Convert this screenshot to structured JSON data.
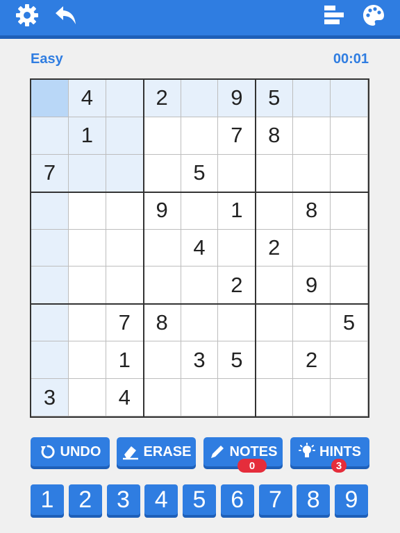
{
  "header": {
    "icons": [
      "gear-icon",
      "undo-arrow-icon",
      "stats-icon",
      "palette-icon"
    ]
  },
  "status": {
    "difficulty": "Easy",
    "timer": "00:01"
  },
  "board": {
    "rows": [
      [
        "",
        "4",
        "",
        "2",
        "",
        "9",
        "5",
        "",
        ""
      ],
      [
        "",
        "1",
        "",
        "",
        "",
        "7",
        "8",
        "",
        ""
      ],
      [
        "7",
        "",
        "",
        "",
        "5",
        "",
        "",
        "",
        ""
      ],
      [
        "",
        "",
        "",
        "9",
        "",
        "1",
        "",
        "8",
        ""
      ],
      [
        "",
        "",
        "",
        "",
        "4",
        "",
        "2",
        "",
        ""
      ],
      [
        "",
        "",
        "",
        "",
        "",
        "2",
        "",
        "9",
        ""
      ],
      [
        "",
        "",
        "7",
        "8",
        "",
        "",
        "",
        "",
        "5"
      ],
      [
        "",
        "",
        "1",
        "",
        "3",
        "5",
        "",
        "2",
        ""
      ],
      [
        "3",
        "",
        "4",
        "",
        "",
        "",
        "",
        "",
        ""
      ]
    ],
    "selected": [
      0,
      0
    ],
    "colors": {
      "selected": "#b9d7f7",
      "highlight": "#e6f0fb",
      "accent": "#2f7de1"
    }
  },
  "actions": {
    "undo": "UNDO",
    "erase": "ERASE",
    "notes": "NOTES",
    "notes_badge": "0",
    "hints": "HINTS",
    "hints_badge": "3"
  },
  "numpad": [
    "1",
    "2",
    "3",
    "4",
    "5",
    "6",
    "7",
    "8",
    "9"
  ]
}
